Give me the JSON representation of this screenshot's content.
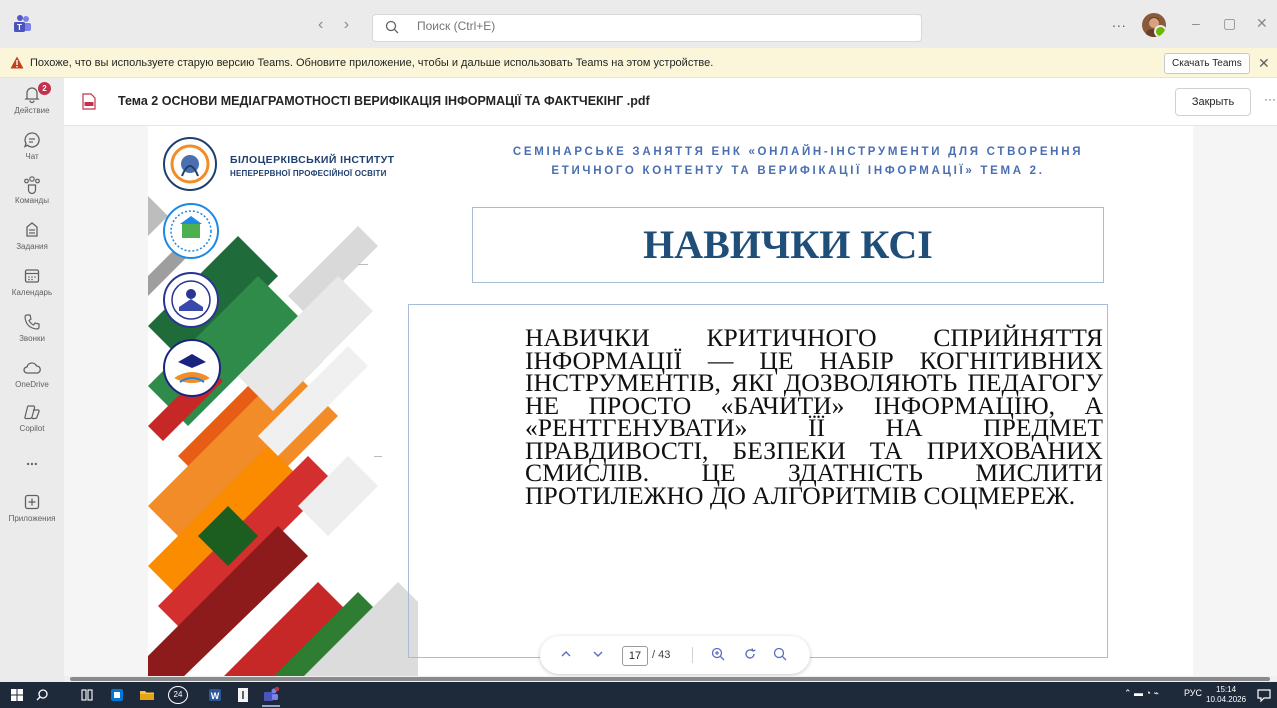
{
  "titlebar": {
    "search_placeholder": "Поиск (Ctrl+E)",
    "more": "...",
    "minimize": "–",
    "restore": "▢",
    "close": "✕"
  },
  "warning": {
    "message": "Похоже, что вы используете старую версию Teams. Обновите приложение, чтобы и дальше использовать Teams на этом устройстве.",
    "download_label": "Скачать Teams",
    "close": "✕"
  },
  "rail": {
    "items": [
      {
        "label": "Действие",
        "icon": "bell-icon",
        "badge": "2"
      },
      {
        "label": "Чат",
        "icon": "chat-icon"
      },
      {
        "label": "Команды",
        "icon": "teams-icon"
      },
      {
        "label": "Задания",
        "icon": "assignments-icon"
      },
      {
        "label": "Календарь",
        "icon": "calendar-icon"
      },
      {
        "label": "Звонки",
        "icon": "phone-icon"
      },
      {
        "label": "OneDrive",
        "icon": "cloud-icon"
      },
      {
        "label": "Copilot",
        "icon": "copilot-icon"
      },
      {
        "label": "...",
        "icon": "more-icon"
      },
      {
        "label": "Приложения",
        "icon": "apps-icon"
      }
    ]
  },
  "document": {
    "title": "Тема 2 ОСНОВИ МЕДІАГРАМОТНОСТІ ВЕРИФІКАЦІЯ ІНФОРМАЦІЇ ТА ФАКТЧЕКІНГ .pdf",
    "close_label": "Закрыть",
    "more": "···"
  },
  "slide": {
    "org_name_line1": "БІЛОЦЕРКІВСЬКИЙ ІНСТИТУТ",
    "org_name_line2": "НЕПЕРЕРВНОЇ ПРОФЕСІЙНОЇ ОСВІТИ",
    "seminar_line1": "СЕМІНАРСЬКЕ ЗАНЯТТЯ ЕНК «ОНЛАЙН-ІНСТРУМЕНТИ ДЛЯ СТВОРЕННЯ",
    "seminar_line2": "ЕТИЧНОГО КОНТЕНТУ ТА ВЕРИФІКАЦІЇ ІНФОРМАЦІЇ» ТЕМА 2.",
    "heading": "НАВИЧКИ КСІ",
    "body": "НАВИЧКИ КРИТИЧНОГО СПРИЙНЯТТЯ ІНФОРМАЦІЇ — ЦЕ НАБІР КОГНІТИВНИХ ІНСТРУМЕНТІВ, ЯКІ ДОЗВОЛЯЮТЬ ПЕДАГОГУ НЕ ПРОСТО «БАЧИТИ» ІНФОРМАЦІЮ, А «РЕНТГЕНУВАТИ» ЇЇ НА ПРЕДМЕТ ПРАВДИВОСТІ, БЕЗПЕКИ ТА ПРИХОВАНИХ СМИСЛІВ. ЦЕ ЗДАТНІСТЬ МИСЛИТИ ПРОТИЛЕЖНО ДО АЛГОРИТМІВ СОЦМЕРЕЖ."
  },
  "pager": {
    "current_page": "17",
    "total": "/ 43"
  },
  "taskbar": {
    "badge_count": "24",
    "lang": "РУС",
    "time": "15:14",
    "date": "10.04.2026"
  },
  "colors": {
    "accent": "#4a6fb0",
    "heading": "#1f4e79",
    "warning_bg": "#fbf6d9",
    "notification": "#c4314b"
  }
}
